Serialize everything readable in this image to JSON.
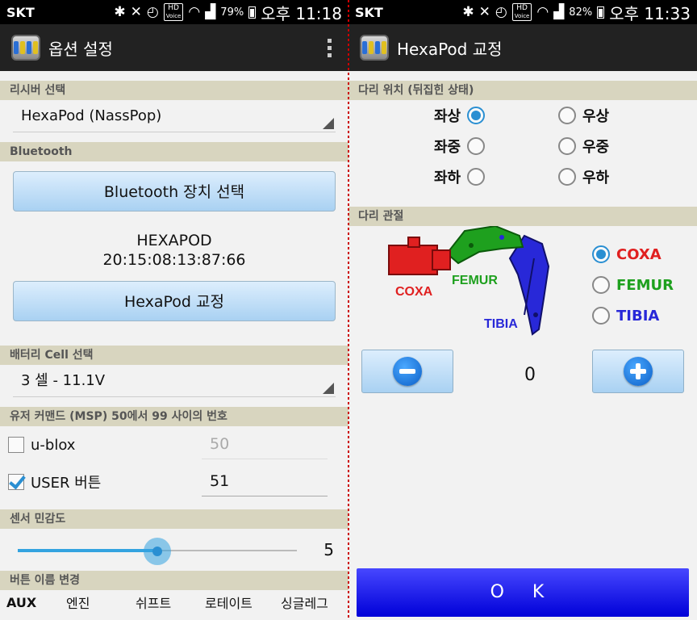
{
  "left": {
    "statusbar": {
      "carrier": "SKT",
      "hd": "HD",
      "hd_sub": "Voice",
      "battery": "79%",
      "time": "오후 11:18"
    },
    "actionbar": {
      "title": "옵션 설정"
    },
    "receiver": {
      "header": "리시버 선택",
      "selected": "HexaPod (NassPop)"
    },
    "bluetooth": {
      "header": "Bluetooth",
      "select_button": "Bluetooth 장치 선택",
      "device_name": "HEXAPOD",
      "device_address": "20:15:08:13:87:66",
      "calibrate_button": "HexaPod 교정"
    },
    "battery_cell": {
      "header": "배터리 Cell 선택",
      "selected": "3 셀 - 11.1V"
    },
    "user_command": {
      "header": "유저 커맨드 (MSP) 50에서 99 사이의 번호",
      "items": [
        {
          "label": "u-blox",
          "checked": false,
          "value": "50"
        },
        {
          "label": "USER 버튼",
          "checked": true,
          "value": "51"
        }
      ]
    },
    "sensor": {
      "header": "센서 민감도",
      "value": "5",
      "fraction": 0.5
    },
    "rename": {
      "header": "버튼 이름 변경",
      "names": [
        "AUX",
        "엔진",
        "쉬프트",
        "로테이트",
        "싱글레그"
      ]
    }
  },
  "right": {
    "statusbar": {
      "carrier": "SKT",
      "hd": "HD",
      "hd_sub": "Voice",
      "battery": "82%",
      "time": "오후 11:33"
    },
    "actionbar": {
      "title": "HexaPod 교정"
    },
    "leg_position": {
      "header": "다리 위치 (뒤집힌 상태)",
      "options": [
        "좌상",
        "우상",
        "좌중",
        "우중",
        "좌하",
        "우하"
      ],
      "selected": "좌상"
    },
    "leg_joint": {
      "header": "다리 관절",
      "image_labels": {
        "coxa": "COXA",
        "femur": "FEMUR",
        "tibia": "TIBIA"
      },
      "options": [
        "COXA",
        "FEMUR",
        "TIBIA"
      ],
      "selected": "COXA",
      "colors": {
        "coxa": "#e02020",
        "femur": "#1ea01e",
        "tibia": "#2828d8"
      }
    },
    "value": "0",
    "ok_button": "O K"
  }
}
